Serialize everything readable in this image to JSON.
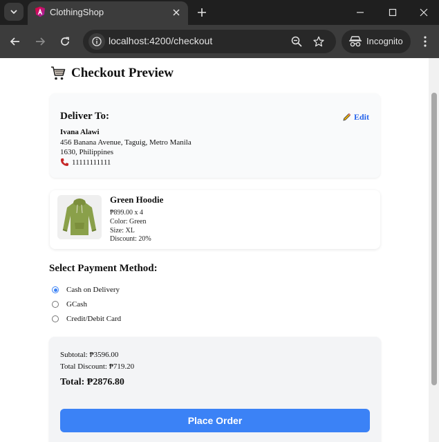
{
  "browser": {
    "tab_title": "ClothingShop",
    "url": "localhost:4200/checkout",
    "incognito_label": "Incognito"
  },
  "page": {
    "title": "Checkout Preview"
  },
  "delivery": {
    "heading": "Deliver To:",
    "edit_label": "Edit",
    "name": "Ivana Alawi",
    "address_line1": "456 Banana Avenue, Taguig, Metro Manila",
    "address_line2": "1630, Philippines",
    "phone": "11111111111"
  },
  "item": {
    "name": "Green Hoodie",
    "price_qty": "₱899.00 x 4",
    "color": "Color: Green",
    "size": "Size: XL",
    "discount": "Discount: 20%"
  },
  "payment": {
    "heading": "Select Payment Method:",
    "options": [
      {
        "label": "Cash on Delivery",
        "selected": true
      },
      {
        "label": "GCash",
        "selected": false
      },
      {
        "label": "Credit/Debit Card",
        "selected": false
      }
    ]
  },
  "summary": {
    "subtotal": "Subtotal: ₱3596.00",
    "total_discount": "Total Discount: ₱719.20",
    "total": "Total: ₱2876.80",
    "place_order_label": "Place Order"
  },
  "colors": {
    "accent": "#3b82f6",
    "link": "#2563eb",
    "chrome_dark": "#1f1f1f"
  }
}
